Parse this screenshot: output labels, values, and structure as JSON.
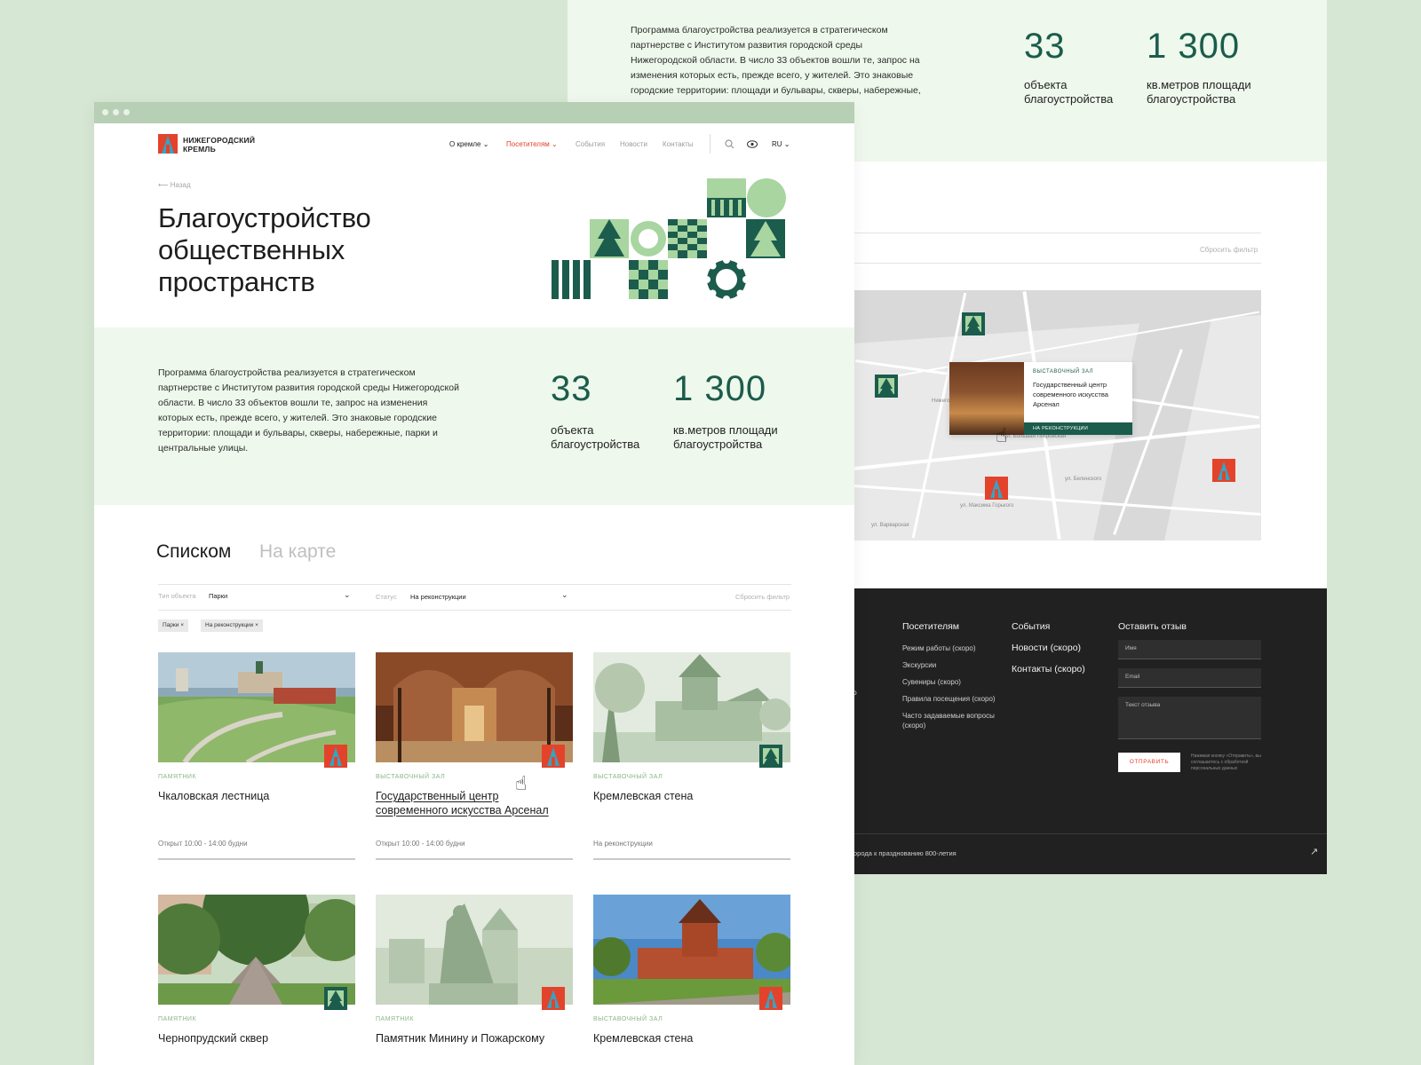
{
  "intro": "Программа благоустройства  реализуется в стратегическом партнерстве с Институтом развития городской среды Нижегородской области. В число 33 объектов вошли те, запрос на изменения которых есть, прежде всего, у жителей. Это знаковые городские территории: площади и бульвары, скверы, набережные, парки и центральные улицы.",
  "intro_back_lines": [
    "Программа благоустройства  реализуется в стратегическом",
    "партнерстве с Институтом развития городской среды",
    "Нижегородской области. В число 33 объектов вошли те, запрос на",
    "изменения которых есть, прежде всего, у жителей. Это знаковые",
    "городские территории: площади и бульвары, скверы, набережные,"
  ],
  "stats": [
    {
      "value": "33",
      "caption_1": "объекта",
      "caption_2": "благоустройства"
    },
    {
      "value": "1 300",
      "caption_1": "кв.метров площади",
      "caption_2": "благоустройства"
    }
  ],
  "logo": {
    "line1": "НИЖЕГОРОДСКИЙ",
    "line2": "КРЕМЛЬ"
  },
  "nav": {
    "items": [
      "О кремле",
      "Посетителям",
      "События",
      "Новости",
      "Контакты"
    ],
    "lang": "RU"
  },
  "back_label": "Назад",
  "title": "Благоустройство общественных пространств",
  "tabs": {
    "list": "Списком",
    "map": "На карте"
  },
  "filters": {
    "type_label": "Тип объекта",
    "type_value": "Парки",
    "status_label": "Статус",
    "status_value": "На реконструкции",
    "reset": "Сбросить фильтр",
    "chips": [
      "Парки",
      "На реконструкции"
    ]
  },
  "cards": [
    {
      "kind": "ПАМЯТНИК",
      "name": "Чкаловская лестница",
      "hours": "Открыт 10:00 - 14:00 будни"
    },
    {
      "kind": "ВЫСТАВОЧНЫЙ ЗАЛ",
      "name": "Государственный центр современного искусства Арсенал",
      "hours": "Открыт 10:00 - 14:00 будни"
    },
    {
      "kind": "ВЫСТАВОЧНЫЙ ЗАЛ",
      "name": "Кремлевская стена",
      "hours": "На реконструкции"
    },
    {
      "kind": "ПАМЯТНИК",
      "name": "Чернопрудский сквер",
      "hours": ""
    },
    {
      "kind": "ПАМЯТНИК",
      "name": "Памятник Минину и Пожарскому",
      "hours": ""
    },
    {
      "kind": "ВЫСТАВОЧНЫЙ ЗАЛ",
      "name": "Кремлевская стена",
      "hours": ""
    }
  ],
  "map_popup": {
    "kicker": "ВЫСТАВОЧНЫЙ ЗАЛ",
    "title": "Государственный центр современного искусства Арсенал",
    "status": "НА РЕКОНСТРУКЦИИ"
  },
  "map_labels": [
    "Нижегородский район",
    "ул. Большая Покровская",
    "ул. Максима Горького",
    "ул. Белинского",
    "ул. Варварская"
  ],
  "footer": {
    "visitors": {
      "heading": "Посетителям",
      "items": [
        "Режим работы (скоро)",
        "Экскурсии",
        "Сувениры (скоро)",
        "Правила посещения (скоро)",
        "Часто задаваемые вопросы (скоро)"
      ]
    },
    "events": "События",
    "news": "Новости (скоро)",
    "contacts": "Контакты (скоро)",
    "feedback": {
      "heading": "Оставить отзыв",
      "name": "Имя",
      "email": "Email",
      "text": "Текст отзыва",
      "send": "ОТПРАВИТЬ",
      "note": "Нажимая кнопку «Отправить», вы соглашаетесь с обработкой персональных данных"
    },
    "bottom": "орода к празднованию 800-летия",
    "left_fragments": [
      "ого",
      ")"
    ]
  },
  "colors": {
    "green_dark": "#1b5c4c",
    "green_light": "#a8d5a0",
    "accent": "#e3432b",
    "band": "#eef8ec"
  }
}
